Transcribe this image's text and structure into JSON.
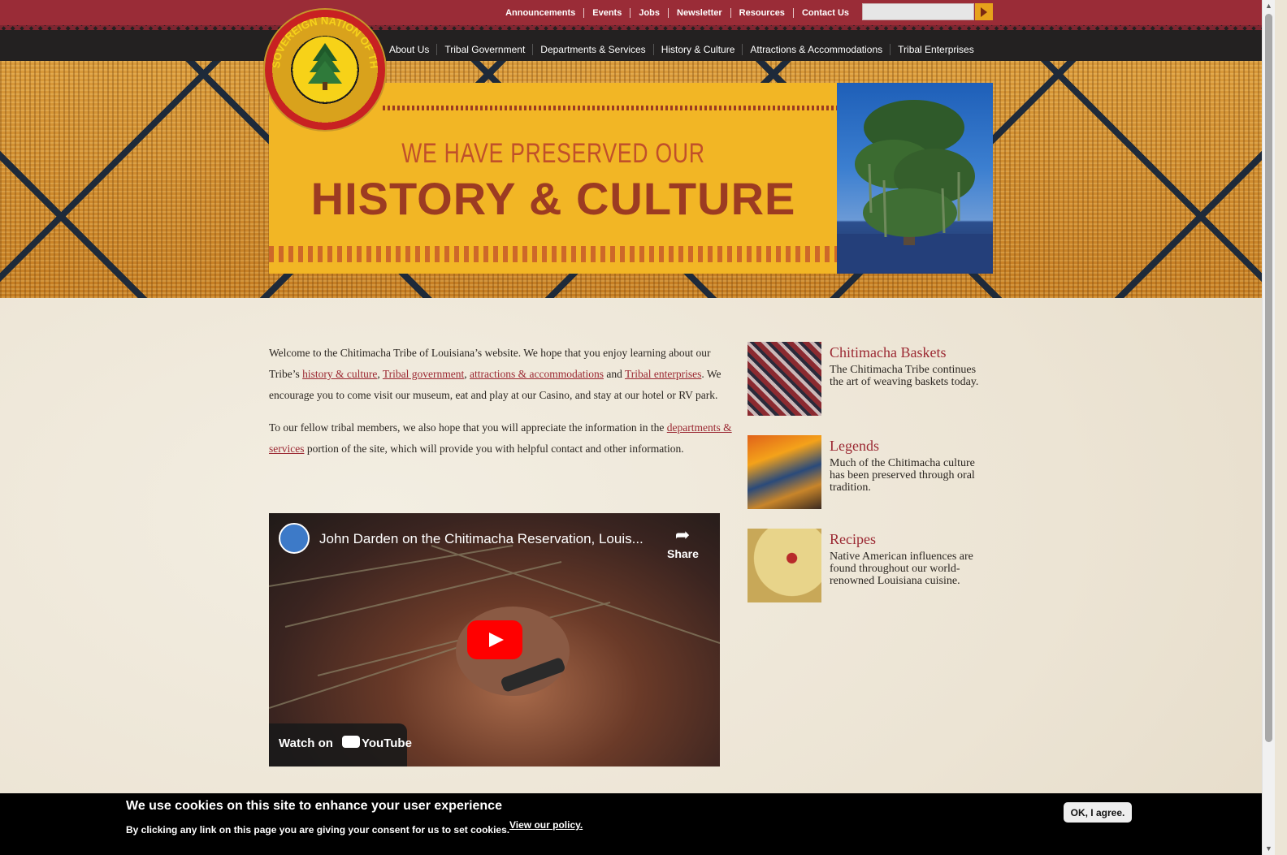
{
  "top_links": [
    "Announcements",
    "Events",
    "Jobs",
    "Newsletter",
    "Resources",
    "Contact Us"
  ],
  "search": {
    "value": "",
    "placeholder": ""
  },
  "logo": {
    "text": "SOVEREIGN NATION OF THE CHITIMACHA"
  },
  "main_nav": [
    "About Us",
    "Tribal Government",
    "Departments & Services",
    "History & Culture",
    "Attractions & Accommodations",
    "Tribal Enterprises"
  ],
  "banner": {
    "subtitle": "WE HAVE PRESERVED OUR",
    "title": "HISTORY & CULTURE"
  },
  "intro": {
    "p1_a": "Welcome to the Chitimacha Tribe of Louisiana’s website. We hope that you enjoy learning about our Tribe’s ",
    "link_history": "history & culture",
    "comma": ", ",
    "link_government": "Tribal government",
    "comma2": ", ",
    "link_attractions": "attractions & accommodations",
    "and": " and ",
    "link_enterprises": "Tribal enterprises",
    "p1_b": ". We encourage you to come visit our museum, eat and play at our Casino, and stay at our hotel or RV park.",
    "p2_a": "To our fellow tribal members, we also hope that you will appreciate the information in the ",
    "link_departments": "departments & services",
    "p2_b": " portion of the site, which will provide you with helpful contact and other information."
  },
  "video": {
    "title": "John Darden on the Chitimacha Reservation, Louis...",
    "share_label": "Share",
    "watch_on": "Watch on",
    "youtube": "YouTube"
  },
  "sidebar": [
    {
      "title": "Chitimacha Baskets",
      "text": "The Chitimacha Tribe continues the art of weaving baskets today."
    },
    {
      "title": "Legends",
      "text": "Much of the Chitimacha culture has been preserved through oral tradition."
    },
    {
      "title": "Recipes",
      "text": "Native American influences are found throughout our world-renowned Louisiana cuisine."
    }
  ],
  "cookie": {
    "title": "We use cookies on this site to enhance your user experience",
    "text": "By clicking any link on this page you are giving your consent for us to set cookies.",
    "link": "View our policy.",
    "button": "OK, I agree."
  },
  "colors": {
    "brand_red": "#9a2c37",
    "nav_dark": "#232121",
    "banner_yellow": "#f2b625",
    "link_red": "#9b2832"
  }
}
